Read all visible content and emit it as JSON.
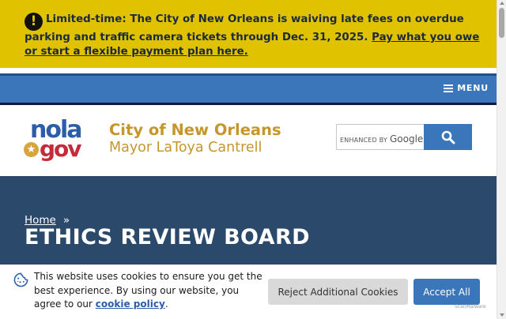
{
  "alert": {
    "icon": "exclamation-icon",
    "icon_glyph": "!",
    "message": "Limited-time: The City of New Orleans is waiving late fees on overdue parking and traffic camera tickets through Dec. 31, 2025.",
    "link_text": "Pay what you owe or start a flexible payment plan here.",
    "background": "#e0c200"
  },
  "menu": {
    "label": "MENU",
    "icon": "hamburger-icon",
    "background": "#3a76b9"
  },
  "header": {
    "logo_nola": "nola",
    "logo_gov": "gov",
    "logo_star": "★",
    "city_name": "City of New Orleans",
    "mayor_name": "Mayor LaToya Cantrell",
    "brand_color": "#c5962a"
  },
  "search": {
    "enhanced_by": "ENHANCED BY",
    "google_label": "Google",
    "button_icon": "search-icon"
  },
  "hero": {
    "breadcrumb_home": "Home",
    "breadcrumb_separator": "»",
    "title": "ETHICS REVIEW BOARD",
    "background": "#2b4a6b"
  },
  "cookie_banner": {
    "icon": "cookie-icon",
    "text_before": "This website uses cookies to ensure you get the best experience. By using our website, you agree to our",
    "link_text": "cookie policy",
    "text_after": ".",
    "reject_label": "Reject Additional Cookies",
    "accept_label": "Accept All",
    "watermark": "ScanMalware"
  }
}
